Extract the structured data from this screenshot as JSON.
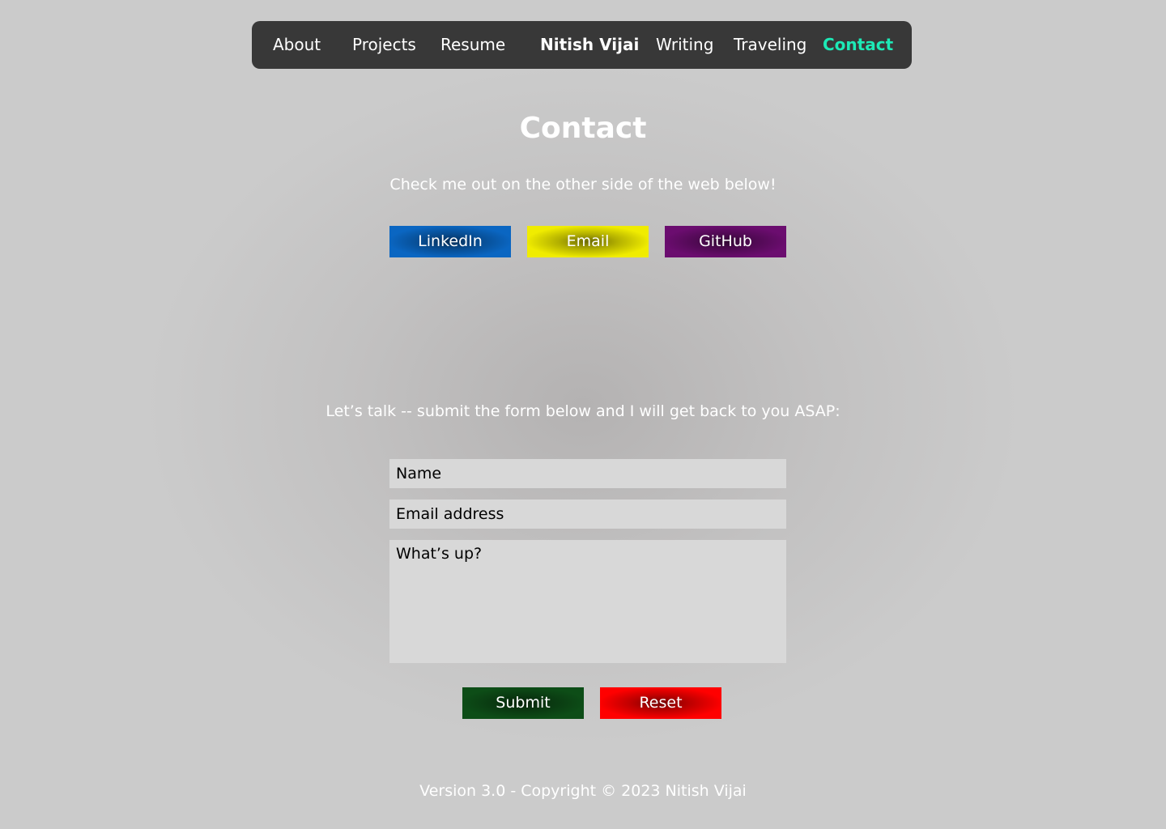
{
  "nav": {
    "about": "About",
    "projects": "Projects",
    "resume": "Resume",
    "brand": "Nitish Vijai",
    "writing": "Writing",
    "traveling": "Traveling",
    "contact": "Contact",
    "active_color": "#1de9b6"
  },
  "main": {
    "title": "Contact",
    "intro": "Check me out on the other side of the web below!",
    "social": {
      "linkedin": "LinkedIn",
      "email": "Email",
      "github": "GitHub"
    },
    "form_intro": "Let’s talk -- submit the form below and I will get back to you ASAP:"
  },
  "form": {
    "name_placeholder": "Name",
    "email_placeholder": "Email address",
    "message_placeholder": "What’s up?",
    "submit": "Submit",
    "reset": "Reset"
  },
  "footer": {
    "text": "Version 3.0 - Copyright © 2023 Nitish Vijai"
  },
  "colors": {
    "linkedin": "#0a66c2",
    "email": "#f0ec00",
    "github": "#6b0d6f",
    "submit": "#0d4d17",
    "reset": "#ff0000",
    "nav_bg": "#383838"
  }
}
